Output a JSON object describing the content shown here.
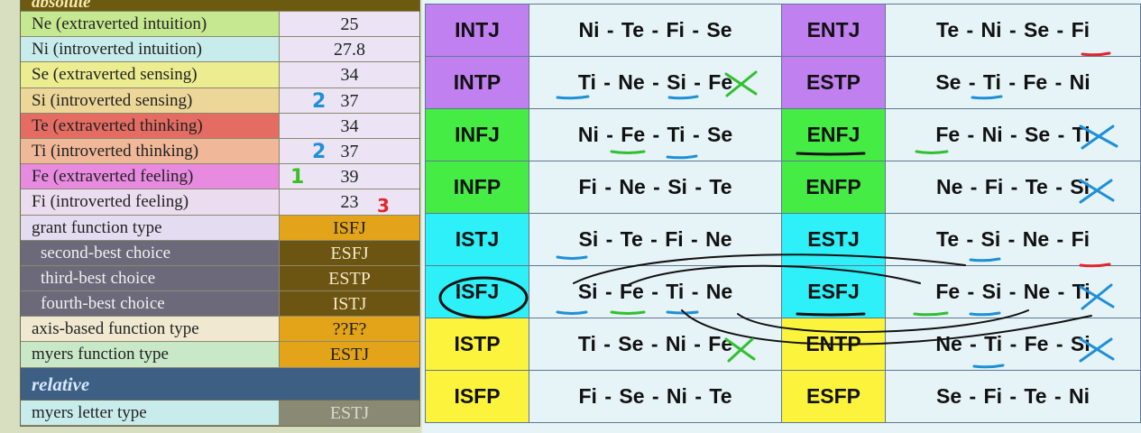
{
  "left_table": {
    "header_label": "absolute",
    "rows": [
      {
        "label": "Ne (extraverted intuition)",
        "value": "25",
        "color": "#c6e890"
      },
      {
        "label": "Ni (introverted intuition)",
        "value": "27.8",
        "color": "#c8ecec"
      },
      {
        "label": "Se (extraverted sensing)",
        "value": "34",
        "color": "#ecec90"
      },
      {
        "label": "Si (introverted sensing)",
        "value": "37",
        "color": "#ecd698"
      },
      {
        "label": "Te (extraverted thinking)",
        "value": "34",
        "color": "#e46c62"
      },
      {
        "label": "Ti (introverted thinking)",
        "value": "37",
        "color": "#f0b898"
      },
      {
        "label": "Fe (extraverted feeling)",
        "value": "39",
        "color": "#e88ae0"
      },
      {
        "label": "Fi (introverted feeling)",
        "value": "23",
        "color": "#ecdcf0"
      },
      {
        "label": "grant function type",
        "value": "ISFJ",
        "color": "#e4dcf0"
      },
      {
        "label": "second-best choice",
        "value": "ESFJ"
      },
      {
        "label": "third-best choice",
        "value": "ESTP"
      },
      {
        "label": "fourth-best choice",
        "value": "ISTJ"
      },
      {
        "label": "axis-based function type",
        "value": "??F?",
        "color": "#f0e8d0"
      },
      {
        "label": "myers function type",
        "value": "ESTJ",
        "color": "#c8e8c8"
      }
    ],
    "relative_label": "relative",
    "relative_row": {
      "label": "myers letter type",
      "value": "ESTJ",
      "color": "#c8ecec"
    },
    "hand_marks": {
      "si": "2",
      "ti": "2",
      "fe": "1",
      "fi": "3"
    }
  },
  "grid": {
    "rows": [
      {
        "t1": "INTJ",
        "c1": "#c080f0",
        "f1": "Ni - Te - Fi - Se",
        "t2": "ENTJ",
        "c2": "#c080f0",
        "f2": "Te - Ni - Se - Fi"
      },
      {
        "t1": "INTP",
        "c1": "#c080f0",
        "f1": "Ti - Ne - Si - Fe",
        "t2": "ESTP",
        "c2": "#c080f0",
        "f2": "Se - Ti - Fe - Ni"
      },
      {
        "t1": "INFJ",
        "c1": "#44ec44",
        "f1": "Ni - Fe - Ti - Se",
        "t2": "ENFJ",
        "c2": "#44ec44",
        "f2": "Fe - Ni - Se - Ti"
      },
      {
        "t1": "INFP",
        "c1": "#44ec44",
        "f1": "Fi - Ne - Si - Te",
        "t2": "ENFP",
        "c2": "#44ec44",
        "f2": "Ne - Fi - Te - Si"
      },
      {
        "t1": "ISTJ",
        "c1": "#2ef0f8",
        "f1": "Si - Te - Fi - Ne",
        "t2": "ESTJ",
        "c2": "#2ef0f8",
        "f2": "Te - Si - Ne - Fi"
      },
      {
        "t1": "ISFJ",
        "c1": "#2ef0f8",
        "f1": "Si - Fe - Ti - Ne",
        "t2": "ESFJ",
        "c2": "#2ef0f8",
        "f2": "Fe - Si - Ne - Ti"
      },
      {
        "t1": "ISTP",
        "c1": "#fcf43c",
        "f1": "Ti - Se - Ni - Fe",
        "t2": "ENTP",
        "c2": "#fcf43c",
        "f2": "Ne - Ti - Fe - Si"
      },
      {
        "t1": "ISFP",
        "c1": "#fcf43c",
        "f1": "Fi - Se - Ni - Te",
        "t2": "ESFP",
        "c2": "#fcf43c",
        "f2": "Se - Fi - Te - Ni"
      }
    ]
  }
}
